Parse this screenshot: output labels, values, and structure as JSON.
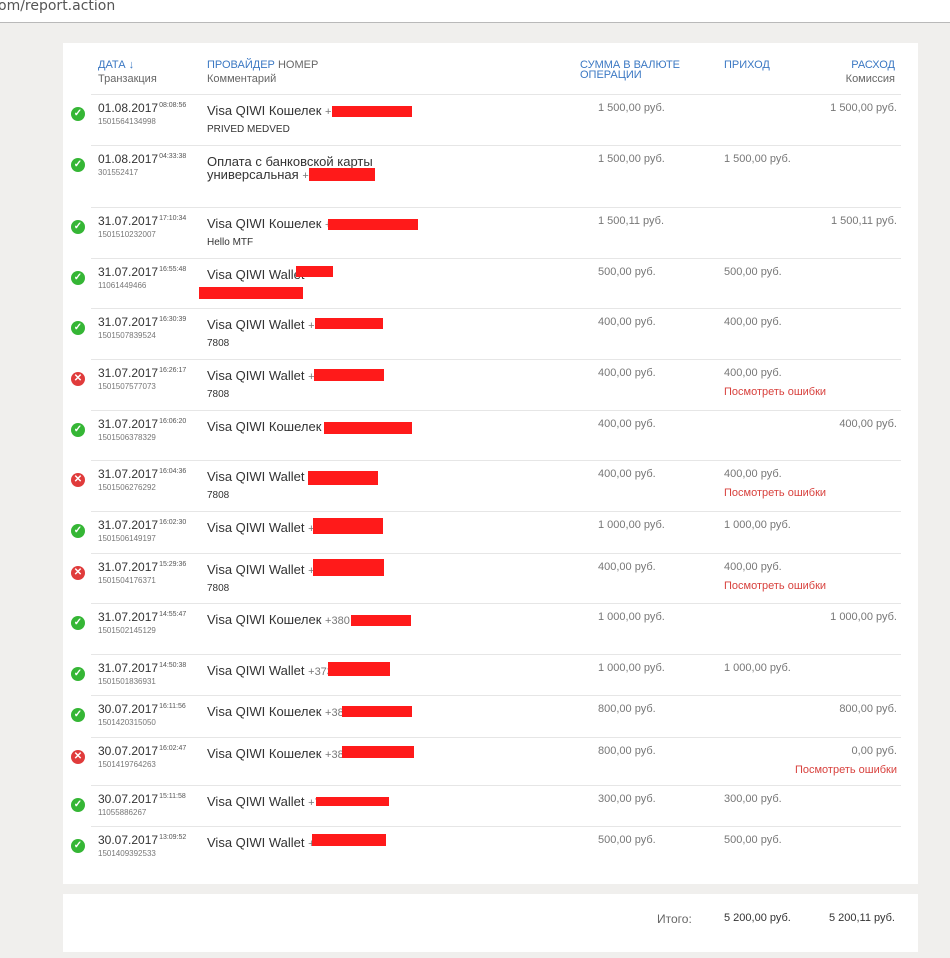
{
  "browser": {
    "url_visible": "om/report.action"
  },
  "table_header": {
    "date_link": "ДАТА ↓",
    "date_sub": "Транзакция",
    "provider_link": "ПРОВАЙДЕР",
    "provider_num": "НОМЕР",
    "provider_sub": "Комментарий",
    "amount_line1": "СУММА В ВАЛЮТЕ",
    "amount_line2": "ОПЕРАЦИИ",
    "income_link": "ПРИХОД",
    "expense_link": "РАСХОД",
    "expense_sub": "Комиссия"
  },
  "colors": {
    "ok": "#35b635",
    "error": "#e03b3b",
    "link": "#3b78c3",
    "error_link": "#d8423e",
    "redaction": "#ff1a1a"
  },
  "rows": [
    {
      "status": "success",
      "date": "01.08.2017",
      "time": "08:08:56",
      "txn": "1501564134998",
      "provider": "Visa QIWI Кошелек",
      "number_visible": "+",
      "comment": "PRIVED MEDVED",
      "amount": "1 500,00 руб.",
      "income": "",
      "expense": "1 500,00 руб.",
      "error_link": ""
    },
    {
      "status": "success",
      "date": "01.08.2017",
      "time": "04:33:38",
      "txn": "301552417",
      "provider": "Оплата с банковской карты",
      "provider_line2": "универсальная",
      "number_visible": "+",
      "comment": "",
      "amount": "1 500,00 руб.",
      "income": "1 500,00 руб.",
      "expense": "",
      "error_link": ""
    },
    {
      "status": "success",
      "date": "31.07.2017",
      "time": "17:10:34",
      "txn": "1501510232007",
      "provider": "Visa QIWI Кошелек",
      "number_visible": "+",
      "comment": "Hello MTF",
      "amount": "1 500,11 руб.",
      "income": "",
      "expense": "1 500,11 руб.",
      "error_link": ""
    },
    {
      "status": "success",
      "date": "31.07.2017",
      "time": "16:55:48",
      "txn": "11061449466",
      "provider": "Visa QIWI Wallet",
      "number_visible": "",
      "comment": "",
      "amount": "500,00 руб.",
      "income": "500,00 руб.",
      "expense": "",
      "error_link": ""
    },
    {
      "status": "success",
      "date": "31.07.2017",
      "time": "16:30:39",
      "txn": "1501507839524",
      "provider": "Visa QIWI Wallet",
      "number_visible": "+",
      "comment": "7808",
      "amount": "400,00 руб.",
      "income": "400,00 руб.",
      "expense": "",
      "error_link": ""
    },
    {
      "status": "error",
      "date": "31.07.2017",
      "time": "16:26:17",
      "txn": "1501507577073",
      "provider": "Visa QIWI Wallet",
      "number_visible": "+7",
      "comment": "7808",
      "amount": "400,00 руб.",
      "income": "400,00 руб.",
      "expense": "",
      "error_link": "Посмотреть ошибки"
    },
    {
      "status": "success",
      "date": "31.07.2017",
      "time": "16:06:20",
      "txn": "1501506378329",
      "provider": "Visa QIWI Кошелек",
      "number_visible": "",
      "comment": "",
      "amount": "400,00 руб.",
      "income": "",
      "expense": "400,00 руб.",
      "error_link": ""
    },
    {
      "status": "error",
      "date": "31.07.2017",
      "time": "16:04:36",
      "txn": "1501506276292",
      "provider": "Visa QIWI Wallet",
      "number_visible": "",
      "comment": "7808",
      "amount": "400,00 руб.",
      "income": "400,00 руб.",
      "expense": "",
      "error_link": "Посмотреть ошибки"
    },
    {
      "status": "success",
      "date": "31.07.2017",
      "time": "16:02:30",
      "txn": "1501506149197",
      "provider": "Visa QIWI Wallet",
      "number_visible": "+",
      "comment": "",
      "amount": "1 000,00 руб.",
      "income": "1 000,00 руб.",
      "expense": "",
      "error_link": ""
    },
    {
      "status": "error",
      "date": "31.07.2017",
      "time": "15:29:36",
      "txn": "1501504176371",
      "provider": "Visa QIWI Wallet",
      "number_visible": "+",
      "comment": "7808",
      "amount": "400,00 руб.",
      "income": "400,00 руб.",
      "expense": "",
      "error_link": "Посмотреть ошибки"
    },
    {
      "status": "success",
      "date": "31.07.2017",
      "time": "14:55:47",
      "txn": "1501502145129",
      "provider": "Visa QIWI Кошелек",
      "number_visible": "+380",
      "comment": "",
      "amount": "1 000,00 руб.",
      "income": "",
      "expense": "1 000,00 руб.",
      "error_link": ""
    },
    {
      "status": "success",
      "date": "31.07.2017",
      "time": "14:50:38",
      "txn": "1501501836931",
      "provider": "Visa QIWI Wallet",
      "number_visible": "+373",
      "comment": "",
      "amount": "1 000,00 руб.",
      "income": "1 000,00 руб.",
      "expense": "",
      "error_link": ""
    },
    {
      "status": "success",
      "date": "30.07.2017",
      "time": "16:11:56",
      "txn": "1501420315050",
      "provider": "Visa QIWI Кошелек",
      "number_visible": "+38",
      "comment": "",
      "amount": "800,00 руб.",
      "income": "",
      "expense": "800,00 руб.",
      "error_link": ""
    },
    {
      "status": "error",
      "date": "30.07.2017",
      "time": "16:02:47",
      "txn": "1501419764263",
      "provider": "Visa QIWI Кошелек",
      "number_visible": "+38",
      "comment": "",
      "amount": "800,00 руб.",
      "income": "",
      "expense": "0,00 руб.",
      "error_link": "Посмотреть ошибки"
    },
    {
      "status": "success",
      "date": "30.07.2017",
      "time": "15:11:58",
      "txn": "11055886267",
      "provider": "Visa QIWI Wallet",
      "number_visible": "+7",
      "comment": "",
      "amount": "300,00 руб.",
      "income": "300,00 руб.",
      "expense": "",
      "error_link": ""
    },
    {
      "status": "success",
      "date": "30.07.2017",
      "time": "13:09:52",
      "txn": "1501409392533",
      "provider": "Visa QIWI Wallet",
      "number_visible": "+",
      "comment": "",
      "amount": "500,00 руб.",
      "income": "500,00 руб.",
      "expense": "",
      "error_link": ""
    }
  ],
  "totals": {
    "label": "Итого:",
    "income": "5 200,00 руб.",
    "expense": "5 200,11 руб."
  }
}
